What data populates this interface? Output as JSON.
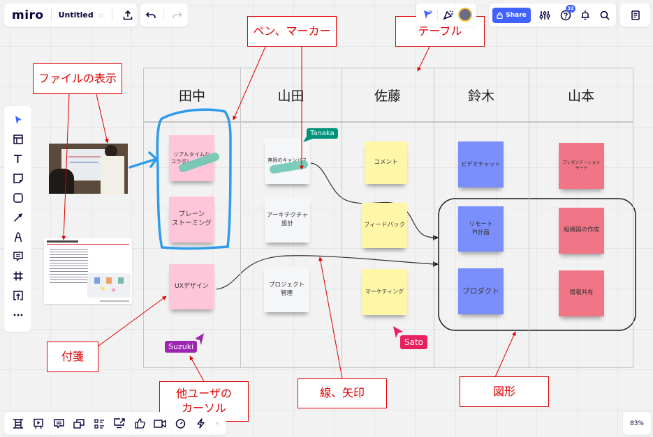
{
  "app": {
    "logo": "miro",
    "board_title": "Untitled",
    "share_label": "Share",
    "notification_count": "32",
    "zoom_level": "83%"
  },
  "icons": {
    "star": "star-icon",
    "export": "upload-icon",
    "undo": "undo-icon",
    "redo": "redo-icon",
    "lock": "lock-icon",
    "settings": "sliders-icon",
    "help": "help-icon",
    "bell": "bell-icon",
    "search": "search-icon",
    "notes": "notes-icon",
    "collapse": "«"
  },
  "left_toolbar": [
    {
      "name": "select-tool",
      "icon": "cursor-icon"
    },
    {
      "name": "templates-tool",
      "icon": "template-icon"
    },
    {
      "name": "text-tool",
      "icon": "text-icon"
    },
    {
      "name": "sticky-note-tool",
      "icon": "sticky-note-icon"
    },
    {
      "name": "shape-tool",
      "icon": "shape-icon"
    },
    {
      "name": "connection-line-tool",
      "icon": "arrow-icon"
    },
    {
      "name": "pen-tool",
      "icon": "pen-icon"
    },
    {
      "name": "comment-tool",
      "icon": "comment-icon"
    },
    {
      "name": "frame-tool",
      "icon": "frame-icon"
    },
    {
      "name": "upload-tool",
      "icon": "upload-icon"
    },
    {
      "name": "more-tools",
      "icon": "more-icon"
    }
  ],
  "bottom_toolbar": [
    {
      "name": "frames",
      "icon": "frames-icon"
    },
    {
      "name": "presentation",
      "icon": "presentation-icon"
    },
    {
      "name": "comments",
      "icon": "comments-icon"
    },
    {
      "name": "screen-share",
      "icon": "screen-share-icon"
    },
    {
      "name": "card-list",
      "icon": "list-icon"
    },
    {
      "name": "share-screen",
      "icon": "cast-icon"
    },
    {
      "name": "voting",
      "icon": "thumbs-up-icon"
    },
    {
      "name": "video-chat",
      "icon": "video-icon"
    },
    {
      "name": "timer",
      "icon": "timer-icon"
    },
    {
      "name": "integrations",
      "icon": "lightning-icon"
    }
  ],
  "table": {
    "columns": [
      "田中",
      "山田",
      "佐藤",
      "鈴木",
      "山本"
    ]
  },
  "stickies": {
    "tanaka": [
      "リアルタイムな\nコラボレーション",
      "ブレーン\nストーミング",
      "UXデザイン"
    ],
    "yamada": [
      "無限のキャンバス",
      "アーキテクチャ\n設計",
      "プロジェクト\n管理"
    ],
    "sato": [
      "コメント",
      "フィードバック",
      "マーケティング"
    ],
    "suzuki": [
      "ビデオチャット",
      "リモート\nPI計画",
      "プロダクト"
    ],
    "yamamoto": [
      "プレゼンテーション\nモード",
      "組織図の作成",
      "情報共有"
    ]
  },
  "cursors": [
    {
      "name": "Tanaka",
      "color": "#00927a"
    },
    {
      "name": "Suzuki",
      "color": "#9b27b0"
    },
    {
      "name": "Sato",
      "color": "#e8215e"
    }
  ],
  "callouts": {
    "file_display": "ファイルの表示",
    "pen_marker": "ペン、マーカー",
    "table": "テーブル",
    "sticky": "付箋",
    "other_cursor": "他ユーザの\nカーソル",
    "line_arrow": "線、矢印",
    "shape": "図形"
  },
  "colors": {
    "accent": "#4262ff",
    "callout_red": "#e00000",
    "pen_blue": "#2f9bec",
    "marker_teal": "#6ec9b4"
  }
}
